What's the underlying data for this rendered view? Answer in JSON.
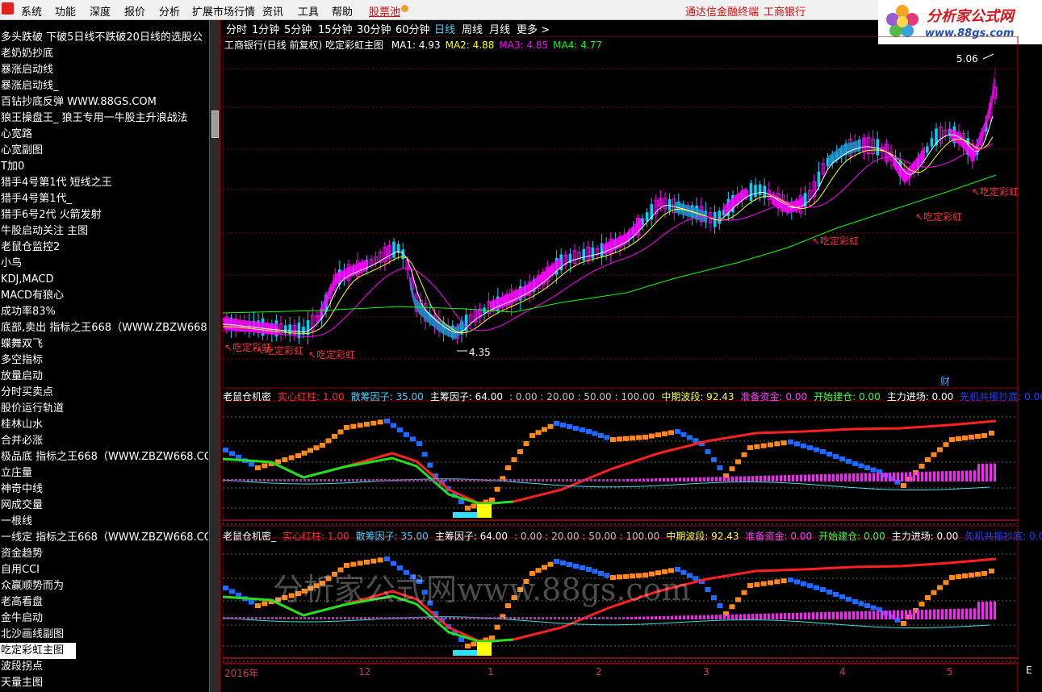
{
  "menu": {
    "items": [
      "系统",
      "功能",
      "深度",
      "报价",
      "分析",
      "扩展市场行情",
      "资讯",
      "工具",
      "帮助"
    ],
    "pool": "股票池",
    "links": [
      "通达信金融终端",
      "工商银行"
    ]
  },
  "logo": {
    "title": "分析家公式网",
    "url": "www.88gs.com"
  },
  "periods": {
    "items": [
      "分时",
      "1分钟",
      "5分钟",
      "15分钟",
      "30分钟",
      "60分钟",
      "日线",
      "周线",
      "月线",
      "更多 >"
    ],
    "active": "日线"
  },
  "sidebar": {
    "items": [
      "多头跌破 下破5日线不跌破20日线的选股公",
      "老奶奶抄底",
      "暴涨启动线",
      "暴涨启动线_",
      "百钻抄底反弹 WWW.88GS.COM",
      "狼王操盘王_ 狼王专用一牛股主升浪战法",
      "心宽路",
      "心宽副图",
      "T加0",
      "猎手4号第1代 短线之王",
      "猎手4号第1代_",
      "猎手6号2代 火箭发射",
      "牛股启动关注 主图",
      "老鼠仓监控2",
      "小鸟",
      "KDJ,MACD",
      "MACD有狼心",
      "成功率83%",
      "底部,卖出 指标之王668（WWW.ZBZW668.CO",
      "蝶舞双飞",
      "多空指标",
      "放量启动",
      "分时买卖点",
      "股价运行轨道",
      "桂林山水",
      "合并必涨",
      "极品底 指标之王668（WWW.ZBZW668.COM）",
      "立庄量",
      "神奇中线",
      "网成交量",
      "一根线",
      "一线定 指标之王668（WWW.ZBZW668.COM）",
      "资金趋势",
      "自用CCI",
      "众赢顺势而为",
      "老高看盘",
      "金牛启动",
      "北沙画线副图",
      "吃定彩虹主图",
      "波段拐点",
      "天量主图"
    ],
    "selected": 38
  },
  "main_chart": {
    "legend": {
      "title": "工商银行(日线 前复权) 吃定彩虹主图",
      "ma": [
        {
          "label": "MA1:",
          "value": "4.93",
          "color": "#ffffff"
        },
        {
          "label": "MA2:",
          "value": "4.88",
          "color": "#ffff00"
        },
        {
          "label": "MA3:",
          "value": "4.85",
          "color": "#ff00ff"
        },
        {
          "label": "MA4:",
          "value": "4.77",
          "color": "#00ff00"
        }
      ]
    },
    "high_label": "5.06",
    "low_label": "4.35",
    "signal_label": "吃定彩虹",
    "cai_label": "财",
    "colors": {
      "up": "#ff00ff",
      "down": "#00d0ff",
      "ma1": "#ffffff",
      "ma2": "#ffff00",
      "ma3": "#ff00ff",
      "ma4": "#00ff00",
      "grid": "#8b0000"
    }
  },
  "sub_chart_1": {
    "legend": [
      {
        "text": "老鼠仓机密",
        "color": "#ffffff"
      },
      {
        "text": "实心红柱: 1.00",
        "color": "#ff3030"
      },
      {
        "text": "散筹因子: 35.00",
        "color": "#50d0ff"
      },
      {
        "text": "主筹因子: 64.00",
        "color": "#ffffff"
      },
      {
        "text": ": 0.00 : 20.00 : 50.00 : 100.00",
        "color": "#c0c0c0"
      },
      {
        "text": "中期波段: 92.43",
        "color": "#ffff40"
      },
      {
        "text": "准备资金: 0.00",
        "color": "#ff40ff"
      },
      {
        "text": "开始建仓: 0.00",
        "color": "#40ff40"
      },
      {
        "text": "主力进场: 0.00",
        "color": "#ffffff"
      },
      {
        "text": "先机共振抄底: 0.00",
        "color": "#2040ff"
      },
      {
        "text": "短线波",
        "color": "#ffffff"
      }
    ]
  },
  "sub_chart_2": {
    "legend": [
      {
        "text": "老鼠仓机密_",
        "color": "#ffffff"
      },
      {
        "text": "实心红柱: 1.00",
        "color": "#ff3030"
      },
      {
        "text": "散筹因子: 35.00",
        "color": "#50d0ff"
      },
      {
        "text": "主筹因子: 64.00",
        "color": "#ffffff"
      },
      {
        "text": ": 0.00 : 20.00 : 50.00 : 100.00",
        "color": "#c0c0c0"
      },
      {
        "text": "中期波段: 92.43",
        "color": "#ffff40"
      },
      {
        "text": "准备资金: 0.00",
        "color": "#ff40ff"
      },
      {
        "text": "开始建仓: 0.00",
        "color": "#40ff40"
      },
      {
        "text": "主力进场: 0.00",
        "color": "#ffffff"
      },
      {
        "text": "先机共振抄底: 0.00",
        "color": "#2040ff"
      },
      {
        "text": "短线",
        "color": "#ffffff"
      }
    ],
    "watermark": "分析家公式网www.88gs.com"
  },
  "time_axis": {
    "labels": [
      "2016年",
      "12",
      "1",
      "2",
      "3",
      "4",
      "5"
    ],
    "corner": "E"
  }
}
